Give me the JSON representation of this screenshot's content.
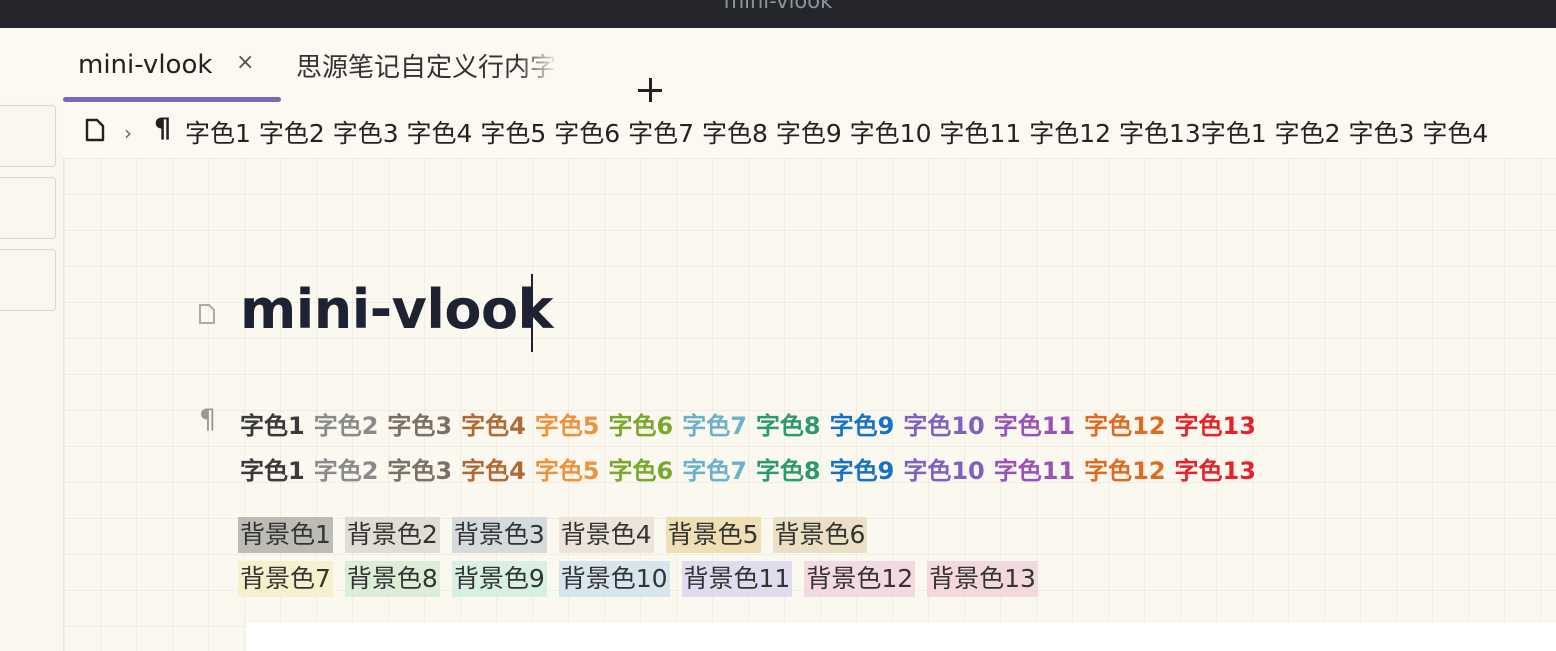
{
  "window": {
    "title": "mini-vlook"
  },
  "tabs": [
    {
      "label": "mini-vlook",
      "close": "×"
    },
    {
      "label": "思源笔记自定义行内字"
    }
  ],
  "breadcrumb": {
    "chevron": "›",
    "pilcrow": "¶",
    "text": "字色1 字色2 字色3 字色4 字色5 字色6 字色7 字色8 字色9 字色10 字色11 字色12 字色13字色1 字色2 字色3 字色4"
  },
  "document": {
    "title": "mini-vlook",
    "block_icon": "¶",
    "font_color_lines": [
      [
        "字色1",
        "字色2",
        "字色3",
        "字色4",
        "字色5",
        "字色6",
        "字色7",
        "字色8",
        "字色9",
        "字色10",
        "字色11",
        "字色12",
        "字色13"
      ],
      [
        "字色1",
        "字色2",
        "字色3",
        "字色4",
        "字色5",
        "字色6",
        "字色7",
        "字色8",
        "字色9",
        "字色10",
        "字色11",
        "字色12",
        "字色13"
      ]
    ],
    "font_colors": [
      "#3a3a3a",
      "#8a8a8a",
      "#7a7066",
      "#b06a35",
      "#f0913c",
      "#7aa82c",
      "#6cb0cc",
      "#2c9a6e",
      "#1672c4",
      "#8060c0",
      "#9a52b8",
      "#df6a22",
      "#e8202a"
    ],
    "background_rows": [
      [
        "背景色1",
        "背景色2",
        "背景色3",
        "背景色4",
        "背景色5",
        "背景色6"
      ],
      [
        "背景色7",
        "背景色8",
        "背景色9",
        "背景色10",
        "背景色11",
        "背景色12",
        "背景色13"
      ]
    ],
    "background_colors": [
      "#bdbbb6",
      "#e2ddd4",
      "#d5dbdc",
      "#ece4d9",
      "#efdfb4",
      "#ece0c4",
      "#f7f0cc",
      "#dceed8",
      "#d6f0e2",
      "#d6e5ee",
      "#e0dcef",
      "#f3d9e2",
      "#f3d9dc"
    ]
  }
}
